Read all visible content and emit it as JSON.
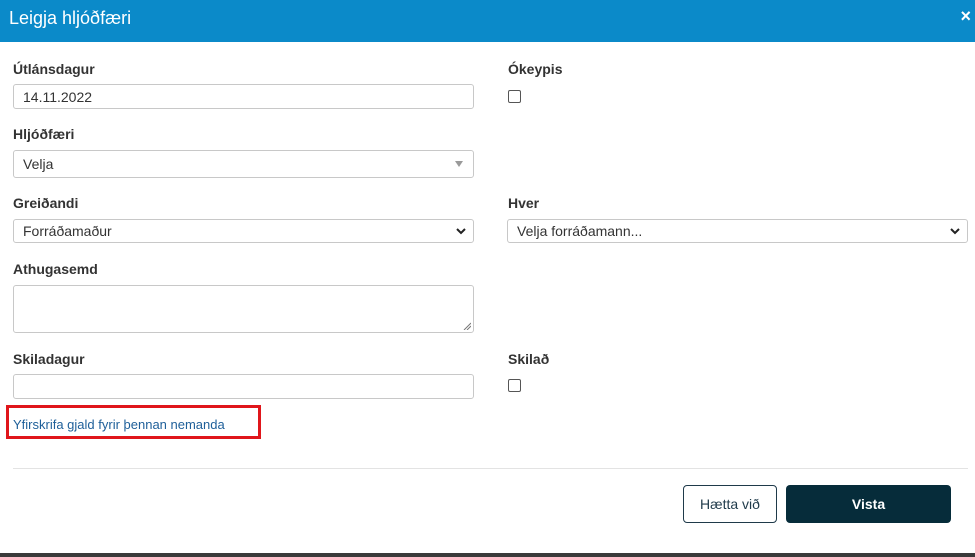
{
  "dialog": {
    "title": "Leigja hljóðfæri",
    "close_glyph": "×"
  },
  "form": {
    "loan_date": {
      "label": "Útlánsdagur",
      "value": "14.11.2022"
    },
    "free": {
      "label": "Ókeypis",
      "checked": false
    },
    "instrument": {
      "label": "Hljóðfæri",
      "selected": "Velja"
    },
    "payer": {
      "label": "Greiðandi",
      "selected": "Forráðamaður"
    },
    "who": {
      "label": "Hver",
      "selected": "Velja forráðamann..."
    },
    "comment": {
      "label": "Athugasemd",
      "value": ""
    },
    "return_date": {
      "label": "Skiladagur",
      "value": ""
    },
    "returned": {
      "label": "Skilað",
      "checked": false
    }
  },
  "override_link": "Yfirskrifa gjald fyrir þennan nemanda",
  "buttons": {
    "cancel_label": "Hætta við",
    "save_label": "Vista"
  },
  "colors": {
    "header": "#0b8ac9",
    "save_button": "#062c3a",
    "highlight": "#e0161b",
    "link": "#1e5f99"
  },
  "icons": {
    "close": "close-icon",
    "select_caret": "caret-down-icon",
    "select_chevron": "chevron-down-icon",
    "resize": "resize-grip-icon"
  }
}
